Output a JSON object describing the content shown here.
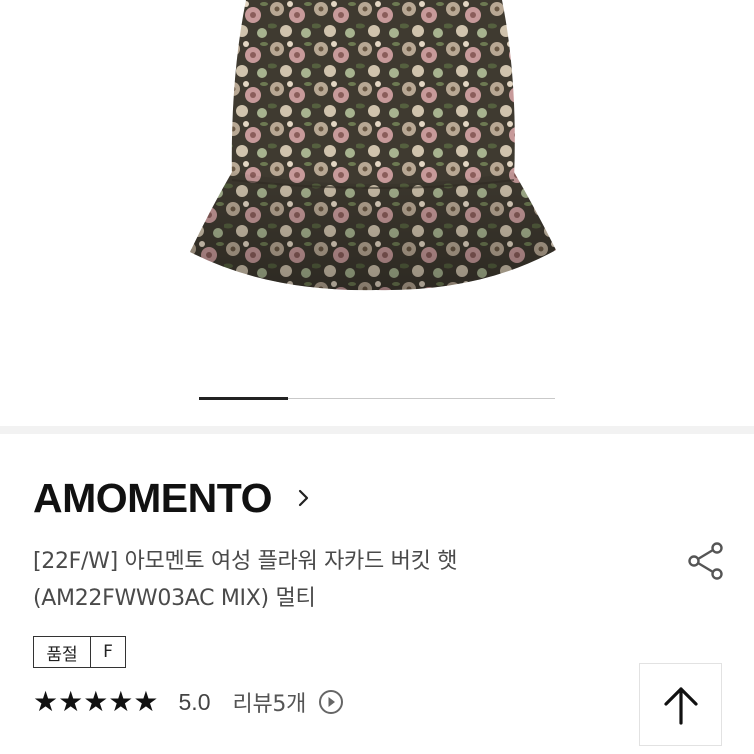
{
  "gallery": {
    "image_alt": "flower jacquard bucket hat",
    "current_slide": 1,
    "total_slides": 4
  },
  "product": {
    "brand": "AMOMENTO",
    "title_line1": "[22F/W] 아모멘토 여성 플라워 자카드 버킷 햇",
    "title_line2": "(AM22FWW03AC MIX) 멀티",
    "quality_label": "품절",
    "quality_value": "F"
  },
  "rating": {
    "stars": "★★★★★",
    "score": "5.0",
    "reviews_label": "리뷰5개"
  },
  "icons": {
    "brand_chevron": "chevron-right-icon",
    "share": "share-icon",
    "reviews_arrow": "play-circle-icon",
    "scroll_top": "arrow-up-icon"
  },
  "colors": {
    "text_primary": "#111111",
    "text_secondary": "#4a4a4a",
    "divider": "#f2f2f2"
  }
}
